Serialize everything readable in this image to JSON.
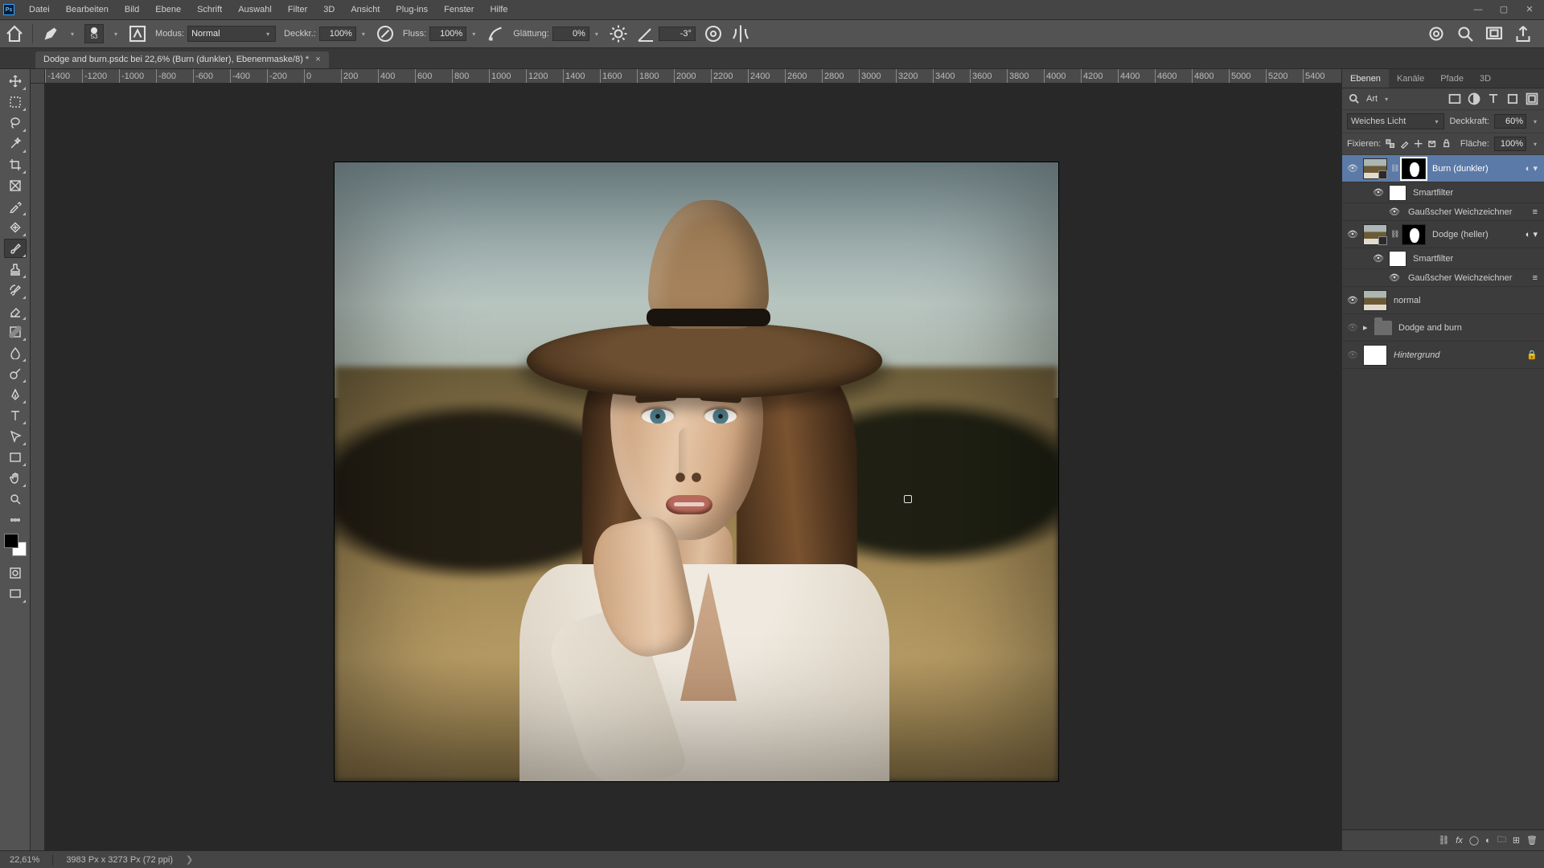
{
  "menu": {
    "items": [
      "Datei",
      "Bearbeiten",
      "Bild",
      "Ebene",
      "Schrift",
      "Auswahl",
      "Filter",
      "3D",
      "Ansicht",
      "Plug-ins",
      "Fenster",
      "Hilfe"
    ]
  },
  "optbar": {
    "brush_size": "53",
    "modus_label": "Modus:",
    "modus_value": "Normal",
    "deckk_label": "Deckkr.:",
    "deckk_value": "100%",
    "fluss_label": "Fluss:",
    "fluss_value": "100%",
    "glatt_label": "Glättung:",
    "glatt_value": "0%",
    "angle_value": "-3°"
  },
  "doc": {
    "tab_title": "Dodge and burn.psdc bei 22,6% (Burn (dunkler), Ebenenmaske/8) *"
  },
  "ruler_h": [
    "-1400",
    "-1200",
    "-1000",
    "-800",
    "-600",
    "-400",
    "-200",
    "0",
    "200",
    "400",
    "600",
    "800",
    "1000",
    "1200",
    "1400",
    "1600",
    "1800",
    "2000",
    "2200",
    "2400",
    "2600",
    "2800",
    "3000",
    "3200",
    "3400",
    "3600",
    "3800",
    "4000",
    "4200",
    "4400",
    "4600",
    "4800",
    "5000",
    "5200",
    "5400"
  ],
  "panels": {
    "tabs": [
      "Ebenen",
      "Kanäle",
      "Pfade",
      "3D"
    ],
    "kind_label": "Art",
    "blend_mode": "Weiches Licht",
    "opacity_label": "Deckkraft:",
    "opacity_value": "60%",
    "lock_label": "Fixieren:",
    "fill_label": "Fläche:",
    "fill_value": "100%"
  },
  "layers": {
    "burn": "Burn (dunkler)",
    "dodge": "Dodge (heller)",
    "smartfilter": "Smartfilter",
    "gauss": "Gaußscher Weichzeichner",
    "normal": "normal",
    "group": "Dodge and burn",
    "bg": "Hintergrund"
  },
  "status": {
    "zoom": "22,61%",
    "dims": "3983 Px x 3273 Px (72 ppi)"
  }
}
